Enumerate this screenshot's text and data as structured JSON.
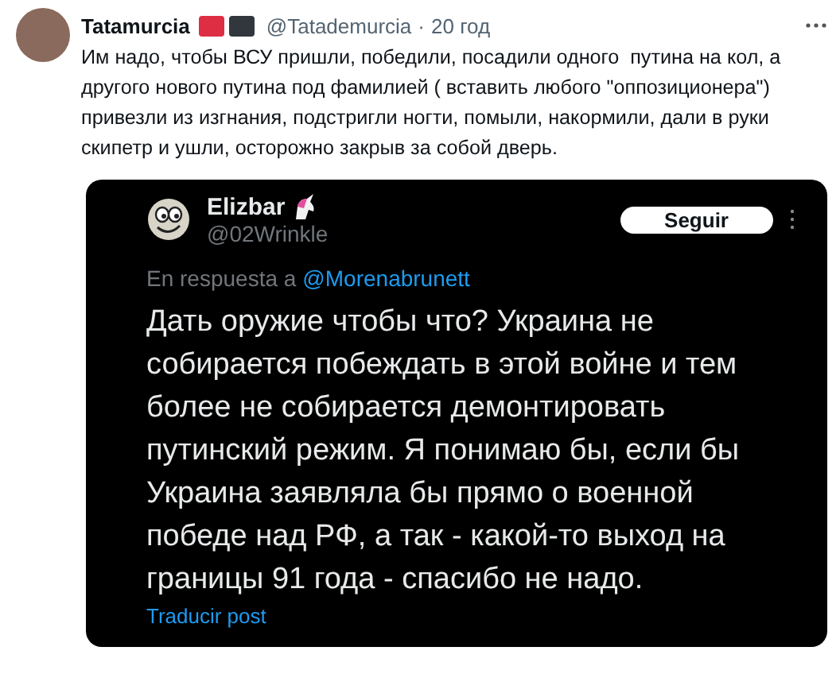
{
  "post": {
    "author": "Tatamurcia",
    "handle": "@Tatademurcia",
    "separator": "·",
    "time": "20 год",
    "text": "Им надо, чтобы ВСУ пришли, победили, посадили одного  путина на кол, а другого нового путина под фамилией ( вставить любого \"оппозиционера\") привезли из изгнания, подстригли ногти, помыли, накормили, дали в руки скипетр и ушли, осторожно закрыв за собой дверь.",
    "embedded": {
      "author": "Elizbar",
      "handle": "@02Wrinkle",
      "follow_button": "Seguir",
      "reply_prefix": "En respuesta a",
      "reply_to": "@Morenabrunett",
      "text": "Дать оружие чтобы что? Украина не собирается побеждать в этой войне и тем более не собирается демонтировать путинский режим. Я понимаю бы, если бы Украина заявляла бы прямо о военной победе над РФ, а так - какой-то выход на границы 91 года - спасибо не надо.",
      "translate_link": "Traducir post"
    }
  }
}
